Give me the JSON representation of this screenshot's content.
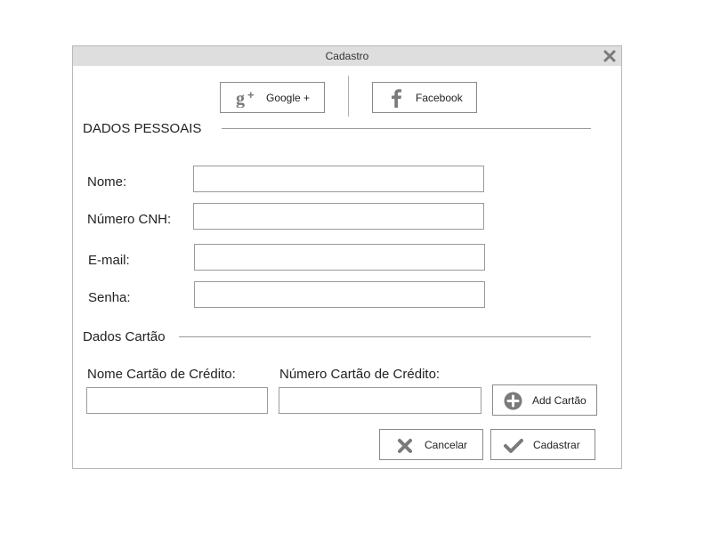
{
  "window": {
    "title": "Cadastro"
  },
  "social": {
    "google_label": "Google +",
    "facebook_label": "Facebook"
  },
  "sections": {
    "personal": "DADOS PESSOAIS",
    "card": "Dados Cartão"
  },
  "fields": {
    "nome": {
      "label": "Nome:",
      "value": ""
    },
    "cnh": {
      "label": "Número CNH:",
      "value": ""
    },
    "email": {
      "label": "E-mail:",
      "value": ""
    },
    "senha": {
      "label": "Senha:",
      "value": ""
    },
    "card_name": {
      "label": "Nome Cartão de Crédito:",
      "value": ""
    },
    "card_number": {
      "label": "Número Cartão de Crédito:",
      "value": ""
    }
  },
  "actions": {
    "add_card": "Add Cartão",
    "cancel": "Cancelar",
    "submit": "Cadastrar"
  },
  "icons": [
    "close-icon",
    "google-plus-icon",
    "facebook-icon",
    "plus-circle-icon",
    "x-icon",
    "checkmark-icon"
  ],
  "colors": {
    "titlebar": "#dedede",
    "icon_gray": "#7a7a7a",
    "border": "#8a8a8a"
  }
}
